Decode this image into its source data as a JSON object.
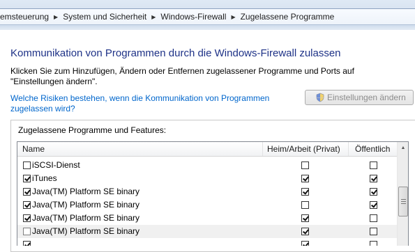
{
  "breadcrumb": [
    "emsteuerung",
    "System und Sicherheit",
    "Windows-Firewall",
    "Zugelassene Programme"
  ],
  "title": "Kommunikation von Programmen durch die Windows-Firewall zulassen",
  "description": "Klicken Sie zum Hinzufügen, Ändern oder Entfernen zugelassener Programme und Ports auf \"Einstellungen ändern\".",
  "risk_link": "Welche Risiken bestehen, wenn die Kommunikation von Programmen zugelassen wird?",
  "settings_button": "Einstellungen ändern",
  "group_label": "Zugelassene Programme und Features:",
  "columns": {
    "name": "Name",
    "home": "Heim/Arbeit (Privat)",
    "public": "Öffentlich"
  },
  "rows": [
    {
      "name": "iSCSI-Dienst",
      "checked": false,
      "home": false,
      "public": false
    },
    {
      "name": "iTunes",
      "checked": true,
      "home": true,
      "public": true
    },
    {
      "name": "Java(TM) Platform SE binary",
      "checked": true,
      "home": true,
      "public": true
    },
    {
      "name": "Java(TM) Platform SE binary",
      "checked": true,
      "home": false,
      "public": true
    },
    {
      "name": "Java(TM) Platform SE binary",
      "checked": true,
      "home": true,
      "public": false
    },
    {
      "name": "Java(TM) Platform SE binary",
      "checked": false,
      "home": true,
      "public": false,
      "selected": true
    },
    {
      "name": "",
      "checked": true,
      "home": true,
      "public": false
    }
  ]
}
